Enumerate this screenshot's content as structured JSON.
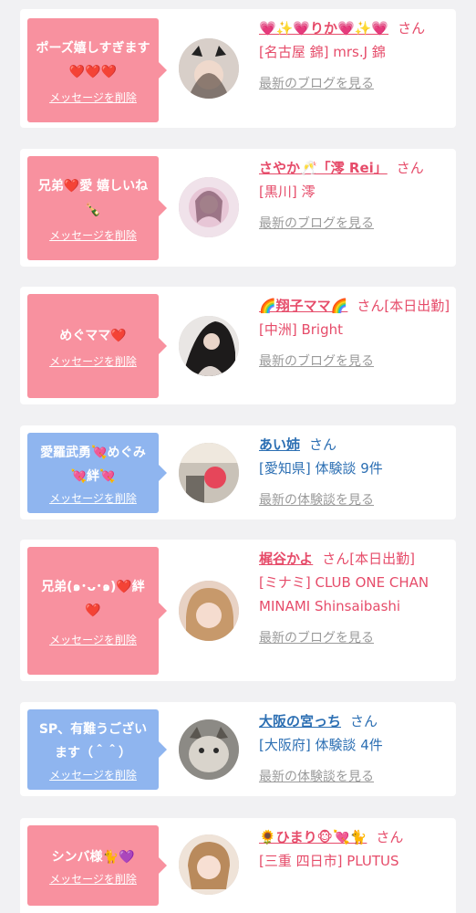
{
  "delete_label": "メッセージを削除",
  "cards": [
    {
      "message": "ポーズ嬉しすぎます❤️❤️❤️",
      "name": "💗✨💗りか💗✨💗",
      "suffix": "さん",
      "shop": "[名古屋 錦] mrs.J 錦",
      "link": "最新のブログを見る"
    },
    {
      "message": "兄弟❤️愛 嬉しいね🍾",
      "name": "さやか🥂「澪 Rei」",
      "suffix": "さん",
      "shop": "[黒川] 澪",
      "link": "最新のブログを見る"
    },
    {
      "message": "めぐママ❤️",
      "name": "🌈翔子ママ🌈",
      "suffix": "さん[本日出勤]",
      "shop": "[中洲] Bright",
      "link": "最新のブログを見る"
    },
    {
      "message": "愛羅武勇💘めぐみ💘絆💘",
      "name": "あい姉",
      "suffix": "さん",
      "shop": "[愛知県] 体験談 9件",
      "link": "最新の体験談を見る"
    },
    {
      "message": "兄弟(๑･ᴗ･๑)❤️絆❤️",
      "name": "梶谷かよ",
      "suffix": "さん[本日出勤]",
      "shop": "[ミナミ] CLUB ONE CHAN MINAMI Shinsaibashi",
      "link": "最新のブログを見る"
    },
    {
      "message": "SP、有難うございます（＾＾）",
      "name": "大阪の宮っち",
      "suffix": "さん",
      "shop": "[大阪府] 体験談 4件",
      "link": "最新の体験談を見る"
    },
    {
      "message": "シンバ様🐈💜",
      "name": "🌻ひまり🐵💘🐈",
      "suffix": "さん",
      "shop": "[三重 四日市] PLUTUS",
      "link": ""
    }
  ],
  "colors": {
    "pink": "#f8919f",
    "blue": "#8fb5ef",
    "name_pink": "#e64c6a",
    "name_blue": "#2c6fb3",
    "link_gray": "#9a9a9a"
  }
}
